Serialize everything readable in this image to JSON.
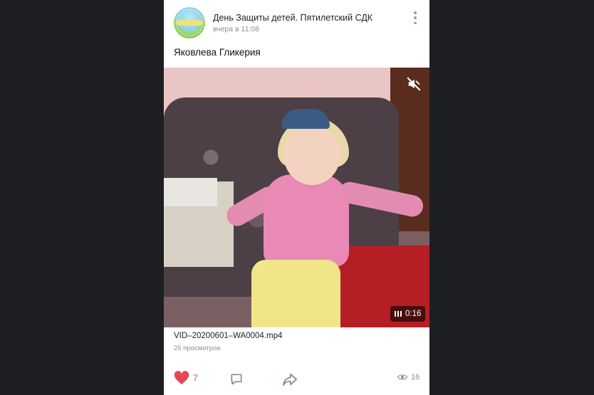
{
  "post": {
    "group_name": "День Защиты детей. Пятилетский СДК",
    "time": "вчера в 11:08",
    "text": "Яковлева Гликерия",
    "video": {
      "duration": "0:16",
      "muted": true
    },
    "file_name": "VID–20200601–WA0004.mp4",
    "views_label": "25 просмотров",
    "likes": "7",
    "views": "16"
  },
  "colors": {
    "background": "#1d1e22",
    "like": "#e6455a",
    "muted_text": "#8a8f96"
  },
  "icons": [
    "more-vertical-icon",
    "mute-icon",
    "pause-icon",
    "heart-icon",
    "comment-icon",
    "share-icon",
    "eye-icon"
  ]
}
